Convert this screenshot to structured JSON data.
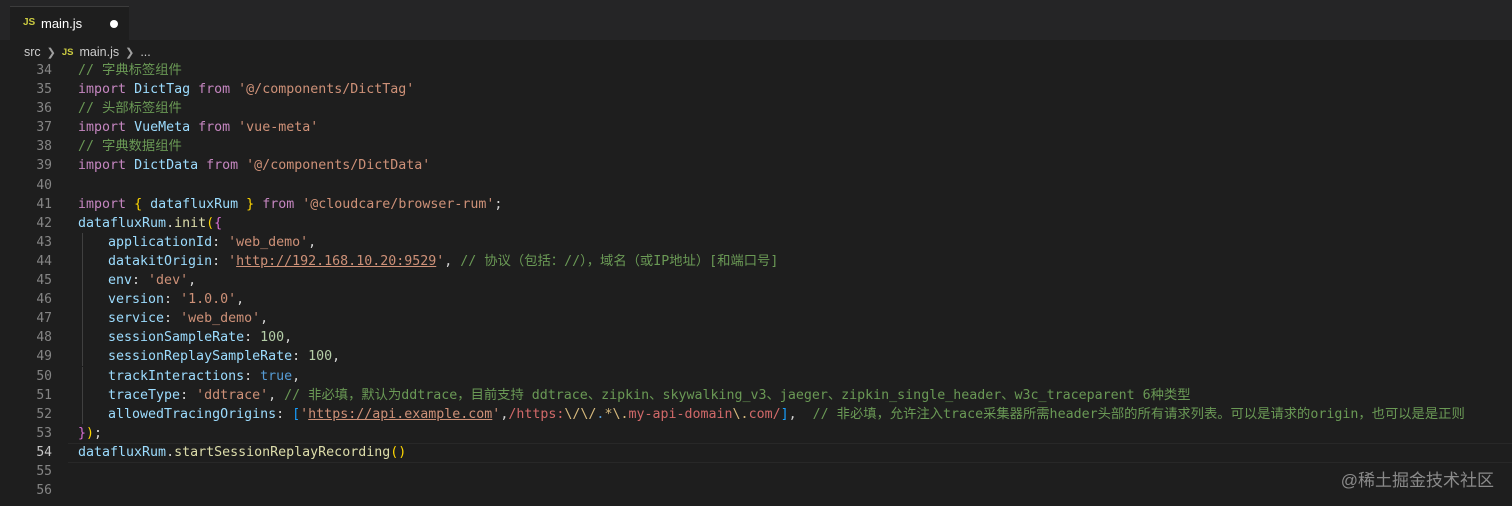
{
  "tab": {
    "icon": "JS",
    "filename": "main.js",
    "modified": true
  },
  "breadcrumb": {
    "folder": "src",
    "file_icon": "JS",
    "file": "main.js",
    "more": "..."
  },
  "line_numbers": [
    "34",
    "35",
    "36",
    "37",
    "38",
    "39",
    "40",
    "41",
    "42",
    "43",
    "44",
    "45",
    "46",
    "47",
    "48",
    "49",
    "50",
    "51",
    "52",
    "53",
    "54",
    "55",
    "56"
  ],
  "current_line": "54",
  "code": {
    "l34": "// 字典标签组件",
    "l35_import": "import",
    "l35_id": "DictTag",
    "l35_from": "from",
    "l35_str": "'@/components/DictTag'",
    "l36": "// 头部标签组件",
    "l37_import": "import",
    "l37_id": "VueMeta",
    "l37_from": "from",
    "l37_str": "'vue-meta'",
    "l38": "// 字典数据组件",
    "l39_import": "import",
    "l39_id": "DictData",
    "l39_from": "from",
    "l39_str": "'@/components/DictData'",
    "l41_import": "import",
    "l41_id": "datafluxRum",
    "l41_from": "from",
    "l41_str": "'@cloudcare/browser-rum'",
    "l42_obj": "datafluxRum",
    "l42_fn": "init",
    "l43_key": "applicationId",
    "l43_val": "'web_demo'",
    "l44_key": "datakitOrigin",
    "l44_url": "http://192.168.10.20:9529",
    "l44_comment": "// 协议（包括：//），域名（或IP地址）[和端口号]",
    "l45_key": "env",
    "l45_val": "'dev'",
    "l46_key": "version",
    "l46_val": "'1.0.0'",
    "l47_key": "service",
    "l47_val": "'web_demo'",
    "l48_key": "sessionSampleRate",
    "l48_val": "100",
    "l49_key": "sessionReplaySampleRate",
    "l49_val": "100",
    "l50_key": "trackInteractions",
    "l50_val": "true",
    "l51_key": "traceType",
    "l51_val": "'ddtrace'",
    "l51_comment": "// 非必填，默认为ddtrace，目前支持 ddtrace、zipkin、skywalking_v3、jaeger、zipkin_single_header、w3c_traceparent 6种类型",
    "l52_key": "allowedTracingOrigins",
    "l52_url": "https://api.example.com",
    "l52_regex_a": "https:",
    "l52_regex_b": "\\/\\/",
    "l52_regex_c": ".",
    "l52_regex_d": "*",
    "l52_regex_e": "\\.",
    "l52_regex_f": "my-api-domain",
    "l52_regex_g": "\\.",
    "l52_regex_h": "com",
    "l52_regex_i": "/",
    "l52_comment": "// 非必填，允许注入trace采集器所需header头部的所有请求列表。可以是请求的origin，也可以是是正则",
    "l54_obj": "datafluxRum",
    "l54_fn": "startSessionReplayRecording"
  },
  "watermark": "@稀土掘金技术社区",
  "colors": {
    "background": "#1e1e1e",
    "keyword": "#c586c0",
    "string": "#ce9178",
    "comment": "#6a9955",
    "number": "#b5cea8",
    "variable": "#9cdcfe",
    "function": "#dcdcaa"
  }
}
